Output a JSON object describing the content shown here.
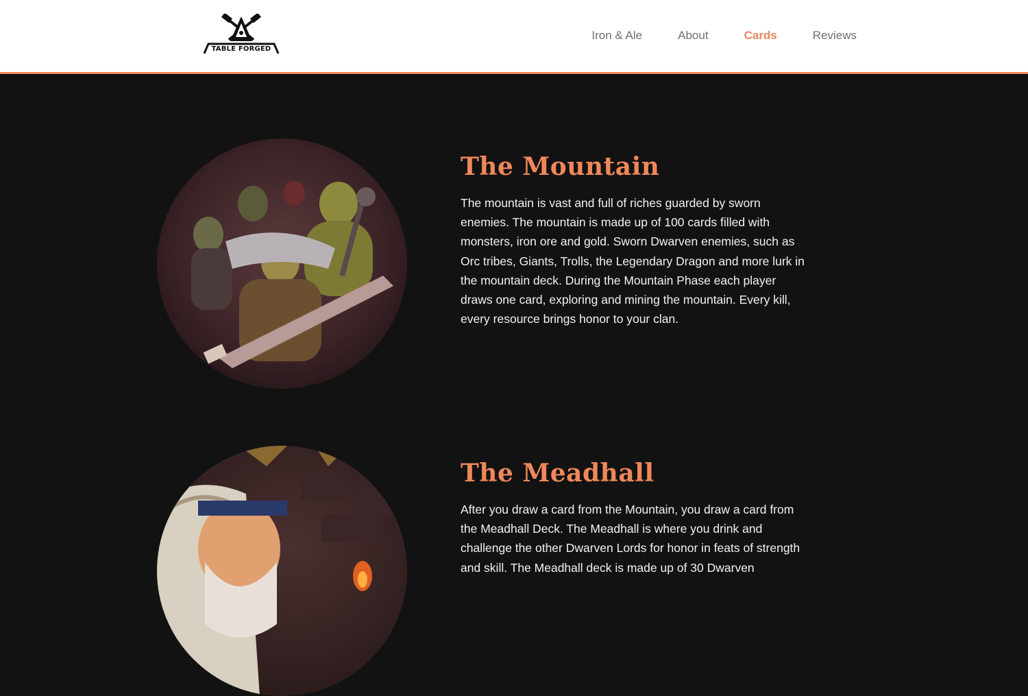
{
  "brand": {
    "logo_text": "TABLE FORGED",
    "logo_icon": "anvil-hammers-icon"
  },
  "nav": {
    "items": [
      {
        "label": "Iron & Ale"
      },
      {
        "label": "About"
      },
      {
        "label": "Cards",
        "active": true
      },
      {
        "label": "Reviews"
      }
    ]
  },
  "sections": [
    {
      "title": "The Mountain",
      "description": "The mountain is vast and full of riches guarded by sworn enemies. The mountain is made up of 100 cards filled with monsters, iron ore and gold. Sworn Dwarven enemies, such as Orc tribes, Giants, Trolls, the Legendary Dragon and more lurk in the mountain deck. During the Mountain Phase each player draws one card, exploring and mining the mountain. Every kill, every resource brings honor to your clan."
    },
    {
      "title": "The Meadhall",
      "description": "After you draw a card from the Mountain, you draw a card from the Meadhall Deck. The Meadhall is where you drink and challenge the other Dwarven Lords for honor in feats of strength and skill. The Meadhall deck is made up of 30 Dwarven"
    }
  ],
  "colors": {
    "accent": "#e8875a",
    "title": "#f0875a",
    "background": "#121212",
    "header_bg": "#ffffff",
    "body_text": "#f2f2f2",
    "nav_text": "#6f6f6f"
  }
}
